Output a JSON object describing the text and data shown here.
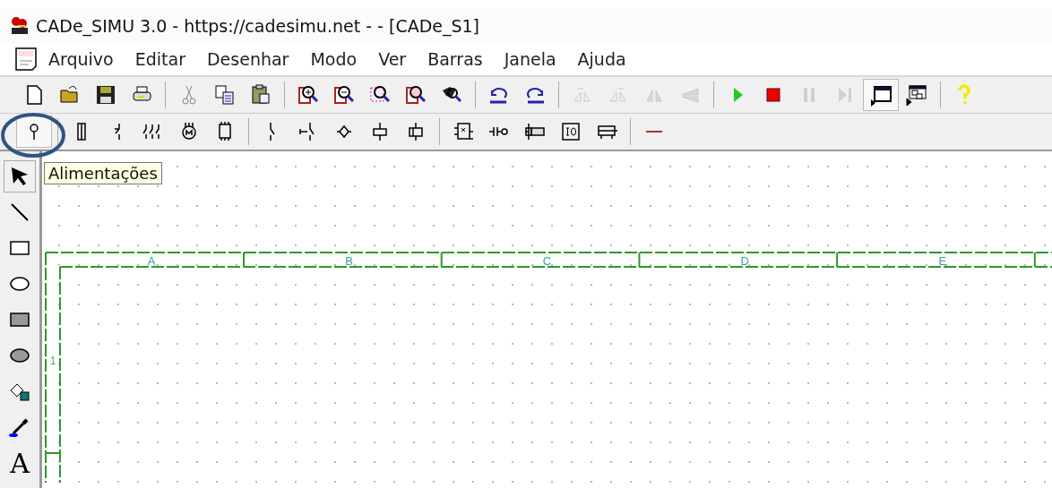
{
  "window": {
    "title": "CADe_SIMU 3.0 - https://cadesimu.net - - [CADe_S1]"
  },
  "menu": [
    "Arquivo",
    "Editar",
    "Desenhar",
    "Modo",
    "Ver",
    "Barras",
    "Janela",
    "Ajuda"
  ],
  "toolbar_main": [
    {
      "kind": "button",
      "disabled": false,
      "pressed": false
    },
    {
      "kind": "button",
      "disabled": false,
      "pressed": false
    },
    {
      "kind": "button",
      "disabled": false,
      "pressed": false
    },
    {
      "kind": "button",
      "disabled": false,
      "pressed": false
    },
    {
      "kind": "separator"
    },
    {
      "kind": "button",
      "disabled": true,
      "pressed": false
    },
    {
      "kind": "button",
      "disabled": false,
      "pressed": false
    },
    {
      "kind": "button",
      "disabled": false,
      "pressed": false
    },
    {
      "kind": "separator"
    },
    {
      "kind": "button",
      "disabled": false,
      "pressed": false
    },
    {
      "kind": "button",
      "disabled": false,
      "pressed": false
    },
    {
      "kind": "button",
      "disabled": false,
      "pressed": false
    },
    {
      "kind": "button",
      "disabled": false,
      "pressed": false
    },
    {
      "kind": "button",
      "disabled": false,
      "pressed": false
    },
    {
      "kind": "separator"
    },
    {
      "kind": "button",
      "disabled": false,
      "pressed": false
    },
    {
      "kind": "button",
      "disabled": false,
      "pressed": false
    },
    {
      "kind": "separator"
    },
    {
      "kind": "button",
      "disabled": true,
      "pressed": false
    },
    {
      "kind": "button",
      "disabled": true,
      "pressed": false
    },
    {
      "kind": "button",
      "disabled": true,
      "pressed": false
    },
    {
      "kind": "button",
      "disabled": true,
      "pressed": false
    },
    {
      "kind": "separator"
    },
    {
      "kind": "button",
      "disabled": false,
      "pressed": false
    },
    {
      "kind": "button",
      "disabled": false,
      "pressed": false
    },
    {
      "kind": "button",
      "disabled": true,
      "pressed": false
    },
    {
      "kind": "button",
      "disabled": true,
      "pressed": false
    },
    {
      "kind": "button",
      "disabled": false,
      "pressed": true
    },
    {
      "kind": "button",
      "disabled": false,
      "pressed": false
    },
    {
      "kind": "separator"
    },
    {
      "kind": "button",
      "disabled": false,
      "pressed": false
    }
  ],
  "toolbar_components": [
    {
      "kind": "button",
      "pressed": true
    },
    {
      "kind": "separator"
    },
    {
      "kind": "button",
      "pressed": false
    },
    {
      "kind": "button",
      "pressed": false
    },
    {
      "kind": "button",
      "pressed": false
    },
    {
      "kind": "button",
      "pressed": false
    },
    {
      "kind": "button",
      "pressed": false
    },
    {
      "kind": "separator"
    },
    {
      "kind": "button",
      "pressed": false
    },
    {
      "kind": "button",
      "pressed": false
    },
    {
      "kind": "button",
      "pressed": false
    },
    {
      "kind": "button",
      "pressed": false
    },
    {
      "kind": "button",
      "pressed": false
    },
    {
      "kind": "separator"
    },
    {
      "kind": "button",
      "pressed": false
    },
    {
      "kind": "button",
      "pressed": false
    },
    {
      "kind": "button",
      "pressed": false
    },
    {
      "kind": "button",
      "pressed": false
    },
    {
      "kind": "button",
      "pressed": false
    },
    {
      "kind": "separator"
    },
    {
      "kind": "button",
      "pressed": false
    }
  ],
  "drawing_tools": [
    {
      "kind": "icon",
      "selected": true
    },
    {
      "kind": "icon",
      "selected": false
    },
    {
      "kind": "icon",
      "selected": false
    },
    {
      "kind": "icon",
      "selected": false
    },
    {
      "kind": "icon",
      "selected": false
    },
    {
      "kind": "icon",
      "selected": false
    },
    {
      "kind": "icon",
      "selected": false
    },
    {
      "kind": "icon",
      "selected": false
    },
    {
      "kind": "text",
      "label": "A",
      "selected": false
    }
  ],
  "tooltip": "Alimentações",
  "sheet": {
    "columns": [
      "A",
      "B",
      "C",
      "D",
      "E"
    ],
    "rows": [
      "1"
    ]
  }
}
